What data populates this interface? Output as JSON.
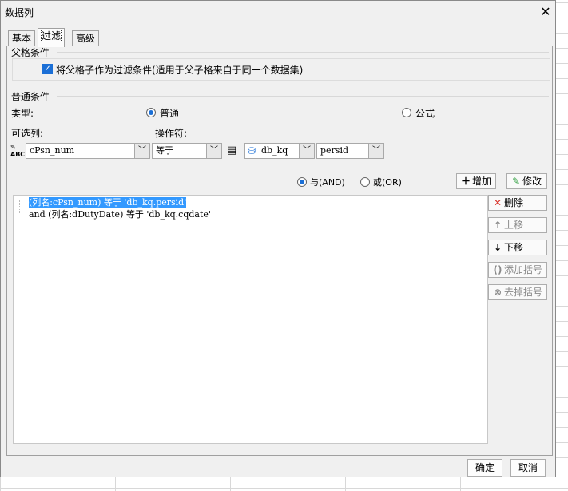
{
  "window": {
    "title": "数据列",
    "close_glyph": "✕"
  },
  "tabs": [
    {
      "label": "基本",
      "active": false
    },
    {
      "label": "过滤",
      "active": true
    },
    {
      "label": "高级",
      "active": false
    }
  ],
  "parent_condition": {
    "title": "父格条件",
    "checkbox_label": "将父格子作为过滤条件(适用于父子格来自于同一个数据集)",
    "checked": true
  },
  "common_condition": {
    "title": "普通条件",
    "type_label": "类型:",
    "type_options": [
      {
        "label": "普通",
        "selected": true
      },
      {
        "label": "公式",
        "selected": false
      }
    ],
    "column_label": "可选列:",
    "operator_label": "操作符:",
    "column_value": "cPsn_num",
    "operator_value": "等于",
    "dataset_value": "db_kq",
    "field_value": "persid"
  },
  "logic": {
    "and_label": "与(AND)",
    "or_label": "或(OR)",
    "and_selected": true,
    "add_button": "增加",
    "modify_button": "修改"
  },
  "conditions": [
    {
      "text": "(列名:cPsn_num) 等于 'db_kq.persid'",
      "selected": true
    },
    {
      "text": "and (列名:dDutyDate) 等于 'db_kq.cqdate'",
      "selected": false
    }
  ],
  "side_buttons": {
    "delete": "删除",
    "move_up": "上移",
    "move_down": "下移",
    "add_bracket": "添加括号",
    "remove_bracket": "去掉括号"
  },
  "footer": {
    "ok": "确定",
    "cancel": "取消"
  },
  "colors": {
    "accent": "#1b6fd6",
    "selection": "#3399ff",
    "delete_red": "#d9342b",
    "modify_green": "#2e9e3e"
  }
}
